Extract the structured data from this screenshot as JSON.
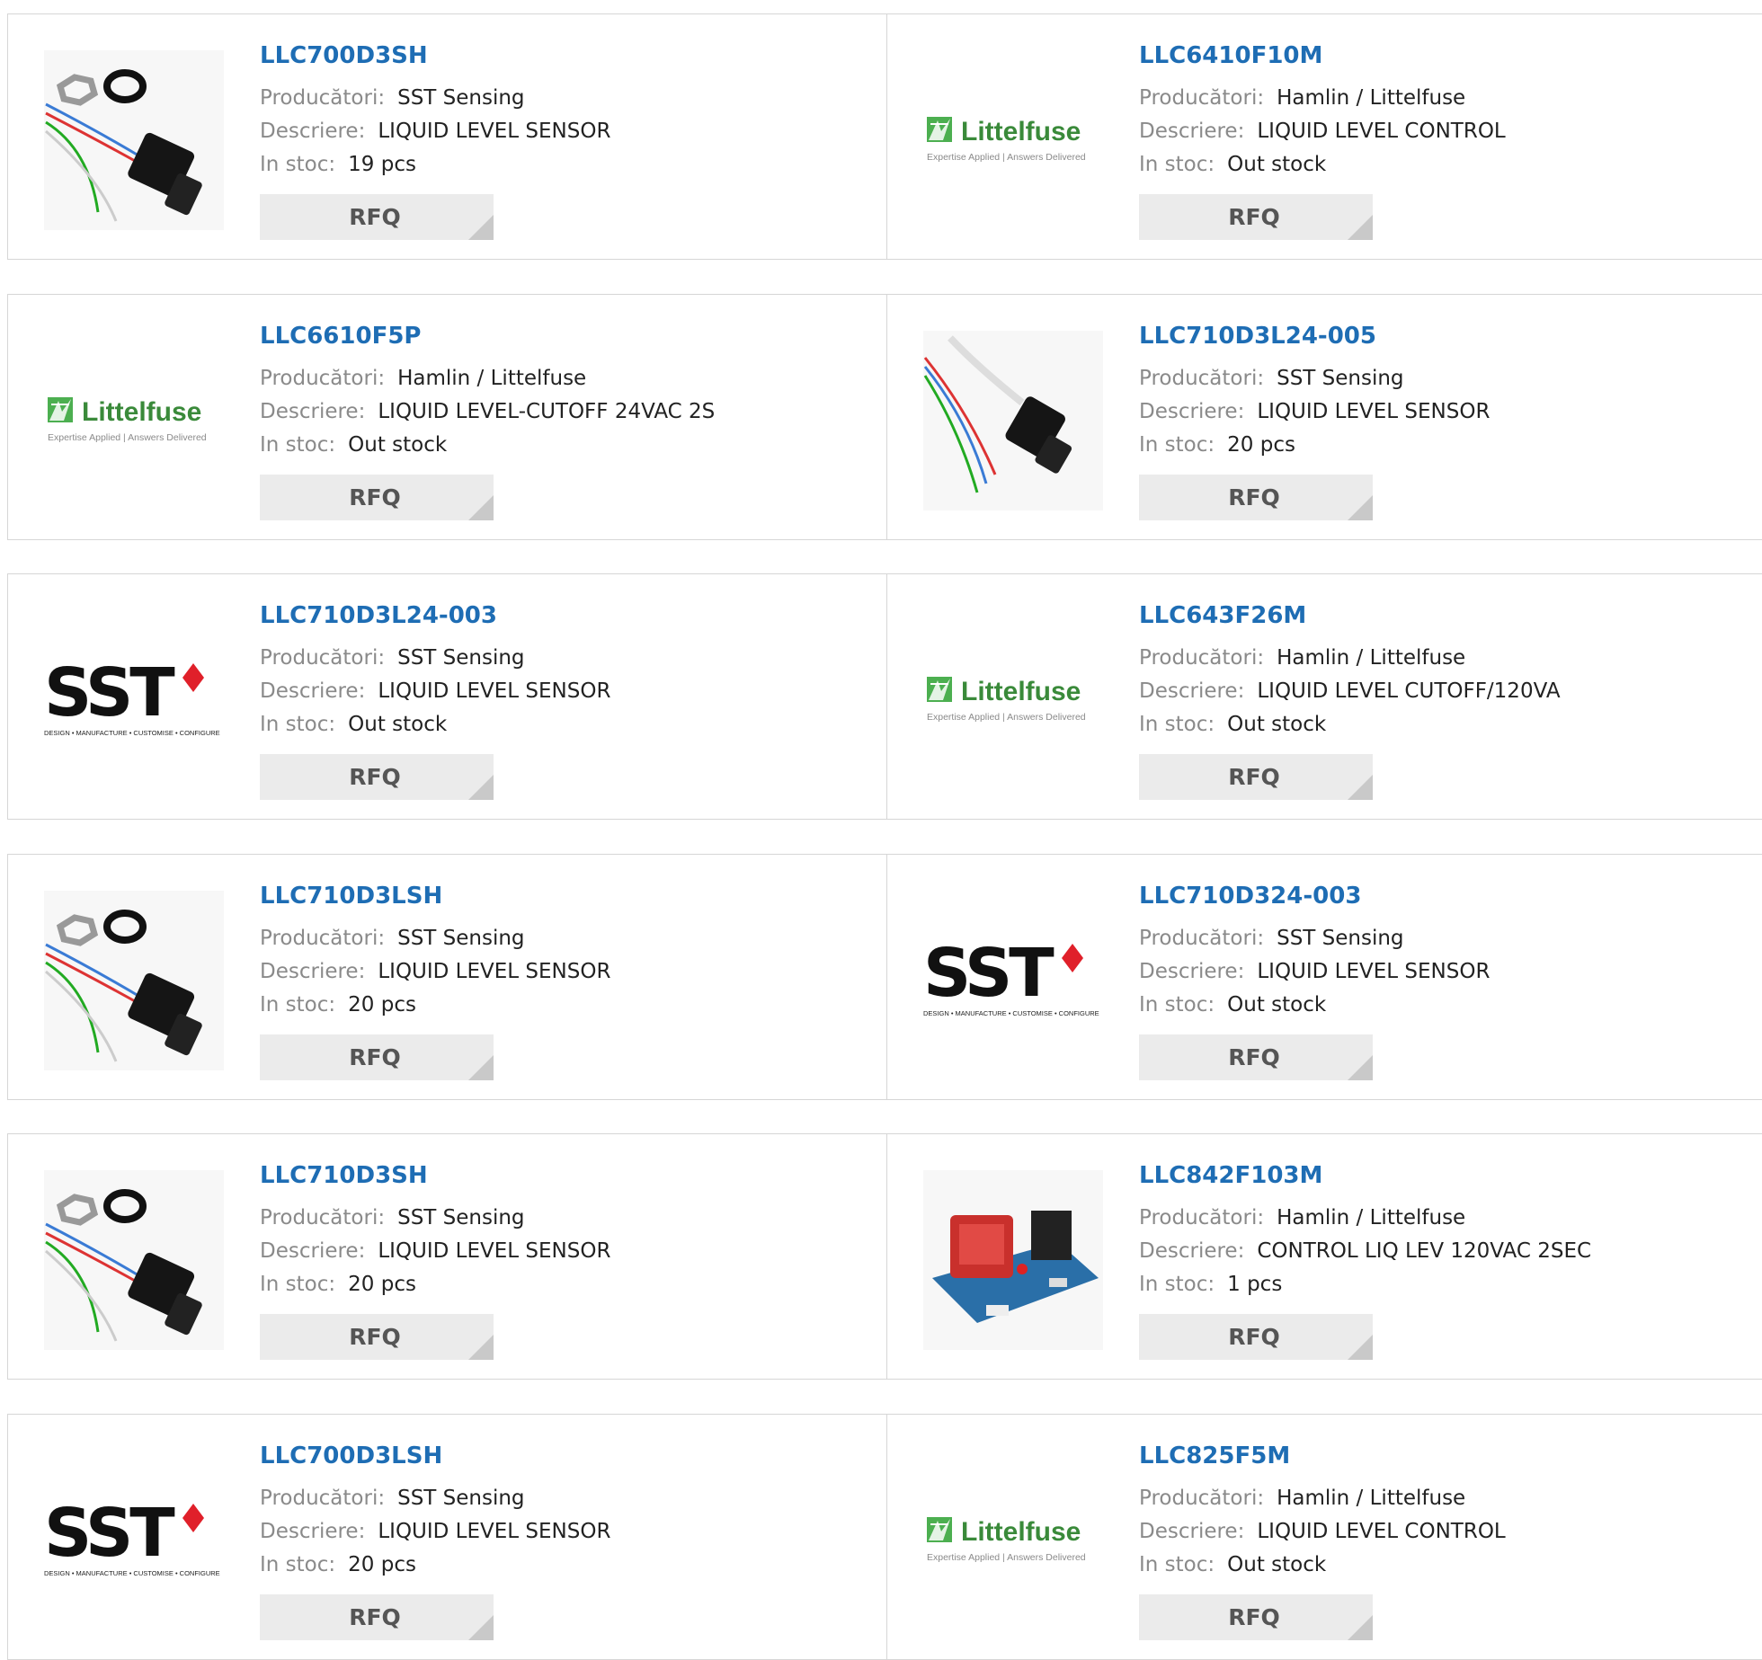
{
  "labels": {
    "manufacturer": "Producători:",
    "description": "Descriere:",
    "stock": "In stoc:",
    "rfq": "RFQ"
  },
  "logos": {
    "littelfuse_name": "Littelfuse",
    "littelfuse_tagline": "Expertise Applied | Answers Delivered",
    "sst_name": "SST",
    "sst_tagline": "DESIGN • MANUFACTURE • CUSTOMISE • CONFIGURE"
  },
  "products": [
    {
      "part": "LLC700D3SH",
      "manufacturer": "SST Sensing",
      "description": "LIQUID LEVEL SENSOR",
      "stock": "19 pcs",
      "image": "sensor-kit"
    },
    {
      "part": "LLC6410F10M",
      "manufacturer": "Hamlin / Littelfuse",
      "description": "LIQUID LEVEL CONTROL",
      "stock": "Out stock",
      "image": "littelfuse-logo"
    },
    {
      "part": "LLC6610F5P",
      "manufacturer": "Hamlin / Littelfuse",
      "description": "LIQUID LEVEL-CUTOFF 24VAC 2S",
      "stock": "Out stock",
      "image": "littelfuse-logo"
    },
    {
      "part": "LLC710D3L24-005",
      "manufacturer": "SST Sensing",
      "description": "LIQUID LEVEL SENSOR",
      "stock": "20 pcs",
      "image": "sensor-cable"
    },
    {
      "part": "LLC710D3L24-003",
      "manufacturer": "SST Sensing",
      "description": "LIQUID LEVEL SENSOR",
      "stock": "Out stock",
      "image": "sst-logo"
    },
    {
      "part": "LLC643F26M",
      "manufacturer": "Hamlin / Littelfuse",
      "description": "LIQUID LEVEL CUTOFF/120VA",
      "stock": "Out stock",
      "image": "littelfuse-logo"
    },
    {
      "part": "LLC710D3LSH",
      "manufacturer": "SST Sensing",
      "description": "LIQUID LEVEL SENSOR",
      "stock": "20 pcs",
      "image": "sensor-kit"
    },
    {
      "part": "LLC710D324-003",
      "manufacturer": "SST Sensing",
      "description": "LIQUID LEVEL SENSOR",
      "stock": "Out stock",
      "image": "sst-logo"
    },
    {
      "part": "LLC710D3SH",
      "manufacturer": "SST Sensing",
      "description": "LIQUID LEVEL SENSOR",
      "stock": "20 pcs",
      "image": "sensor-kit"
    },
    {
      "part": "LLC842F103M",
      "manufacturer": "Hamlin / Littelfuse",
      "description": "CONTROL LIQ LEV 120VAC 2SEC",
      "stock": "1 pcs",
      "image": "pcb-board"
    },
    {
      "part": "LLC700D3LSH",
      "manufacturer": "SST Sensing",
      "description": "LIQUID LEVEL SENSOR",
      "stock": "20 pcs",
      "image": "sst-logo"
    },
    {
      "part": "LLC825F5M",
      "manufacturer": "Hamlin / Littelfuse",
      "description": "LIQUID LEVEL CONTROL",
      "stock": "Out stock",
      "image": "littelfuse-logo"
    }
  ],
  "colors": {
    "part_link": "#1e6db4",
    "label": "#8a8a8a",
    "border": "#d6d6d6",
    "rfq_bg": "#ebebeb",
    "littelfuse_green": "#3a9a3a",
    "sst_red": "#e0202a"
  }
}
